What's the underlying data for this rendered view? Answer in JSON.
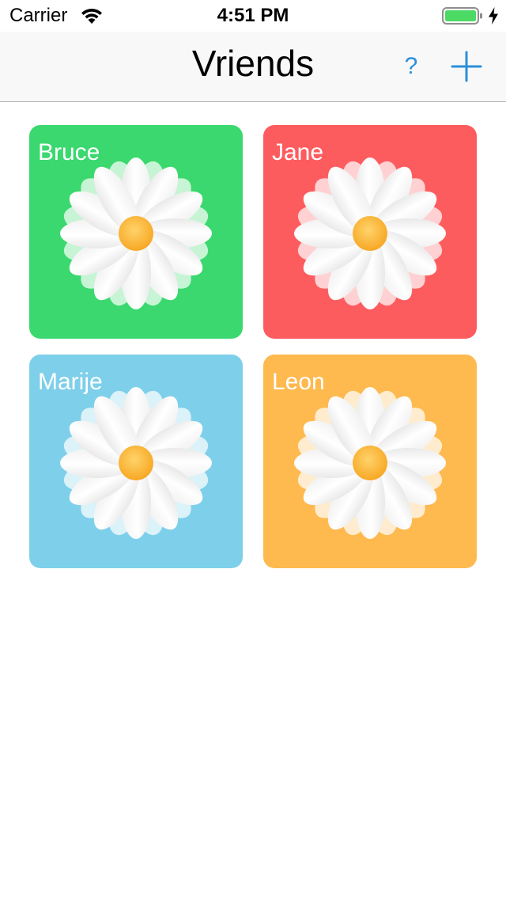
{
  "status_bar": {
    "carrier": "Carrier",
    "time": "4:51 PM",
    "icons": [
      "wifi-icon",
      "battery-icon",
      "charging-icon"
    ],
    "battery_color": "#4cd964"
  },
  "nav": {
    "title": "Vriends",
    "help_label": "?",
    "add_icon": "plus-icon",
    "accent_color": "#2b8fd8"
  },
  "friends": [
    {
      "name": "Bruce",
      "color": "#3ad86e",
      "icon": "daisy-icon"
    },
    {
      "name": "Jane",
      "color": "#fd5c5f",
      "icon": "daisy-icon"
    },
    {
      "name": "Marije",
      "color": "#7ecfea",
      "icon": "daisy-icon"
    },
    {
      "name": "Leon",
      "color": "#feb94f",
      "icon": "daisy-icon"
    }
  ]
}
